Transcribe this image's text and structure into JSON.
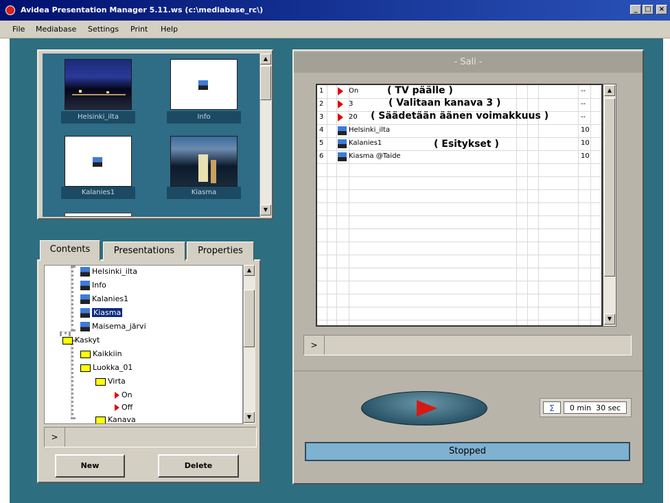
{
  "window": {
    "title": "Avidea Presentation Manager 5.11.ws    (c:\\mediabase_rc\\)",
    "btn_min": "_",
    "btn_max": "□",
    "btn_close": "×"
  },
  "menu": [
    "File",
    "Mediabase",
    "Settings",
    "Print",
    "Help"
  ],
  "thumbnails": [
    {
      "label": "Helsinki_ilta",
      "style": "night-city"
    },
    {
      "label": "Info",
      "style": "blank-icon"
    },
    {
      "label": "Kalanies1",
      "style": "blank-icon"
    },
    {
      "label": "Kiasma",
      "style": "building"
    }
  ],
  "tabs": [
    "Contents",
    "Presentations",
    "Properties"
  ],
  "tree": [
    {
      "label": "Helsinki_ilta",
      "icon": "monitor-icon",
      "level": 2
    },
    {
      "label": "Info",
      "icon": "monitor-icon",
      "level": 2
    },
    {
      "label": "Kalanies1",
      "icon": "monitor-icon",
      "level": 2
    },
    {
      "label": "Kiasma",
      "icon": "monitor-icon",
      "level": 2,
      "selected": true
    },
    {
      "label": "Maisema_järvi",
      "icon": "monitor-icon",
      "level": 2
    },
    {
      "label": "Kaskyt",
      "icon": "folder-open-icon",
      "level": 0
    },
    {
      "label": "Kaikkiin",
      "icon": "folder-icon",
      "level": 1
    },
    {
      "label": "Luokka_01",
      "icon": "folder-open-icon",
      "level": 1
    },
    {
      "label": "Virta",
      "icon": "folder-open-icon",
      "level": 2
    },
    {
      "label": "On",
      "icon": "red-arrow-icon",
      "level": 3
    },
    {
      "label": "Off",
      "icon": "red-arrow-icon",
      "level": 3
    },
    {
      "label": "Kanava",
      "icon": "folder-icon",
      "level": 2
    }
  ],
  "tree_h_btn": ">",
  "buttons": {
    "new": "New",
    "delete": "Delete"
  },
  "panel": {
    "title": "- Sali -"
  },
  "playlist": [
    {
      "num": "1",
      "icon": "red-arrow-icon",
      "name": "On",
      "value": "--"
    },
    {
      "num": "2",
      "icon": "red-arrow-icon",
      "name": "3",
      "value": "--"
    },
    {
      "num": "3",
      "icon": "red-arrow-icon",
      "name": "20",
      "value": "--"
    },
    {
      "num": "4",
      "icon": "monitor-icon",
      "name": "Helsinki_ilta",
      "value": "10"
    },
    {
      "num": "5",
      "icon": "monitor-icon",
      "name": "Kalanies1",
      "value": "10"
    },
    {
      "num": "6",
      "icon": "monitor-icon",
      "name": "Kiasma @Taide",
      "value": "10"
    }
  ],
  "annotations": [
    "( TV päälle )",
    "( Valitaan kanava 3 )",
    "( Säädetään äänen voimakkuus )",
    "( Esitykset )"
  ],
  "grid_h_btn": ">",
  "time": {
    "sigma": "Σ",
    "value": "0 min  30 sec"
  },
  "status": "Stopped"
}
